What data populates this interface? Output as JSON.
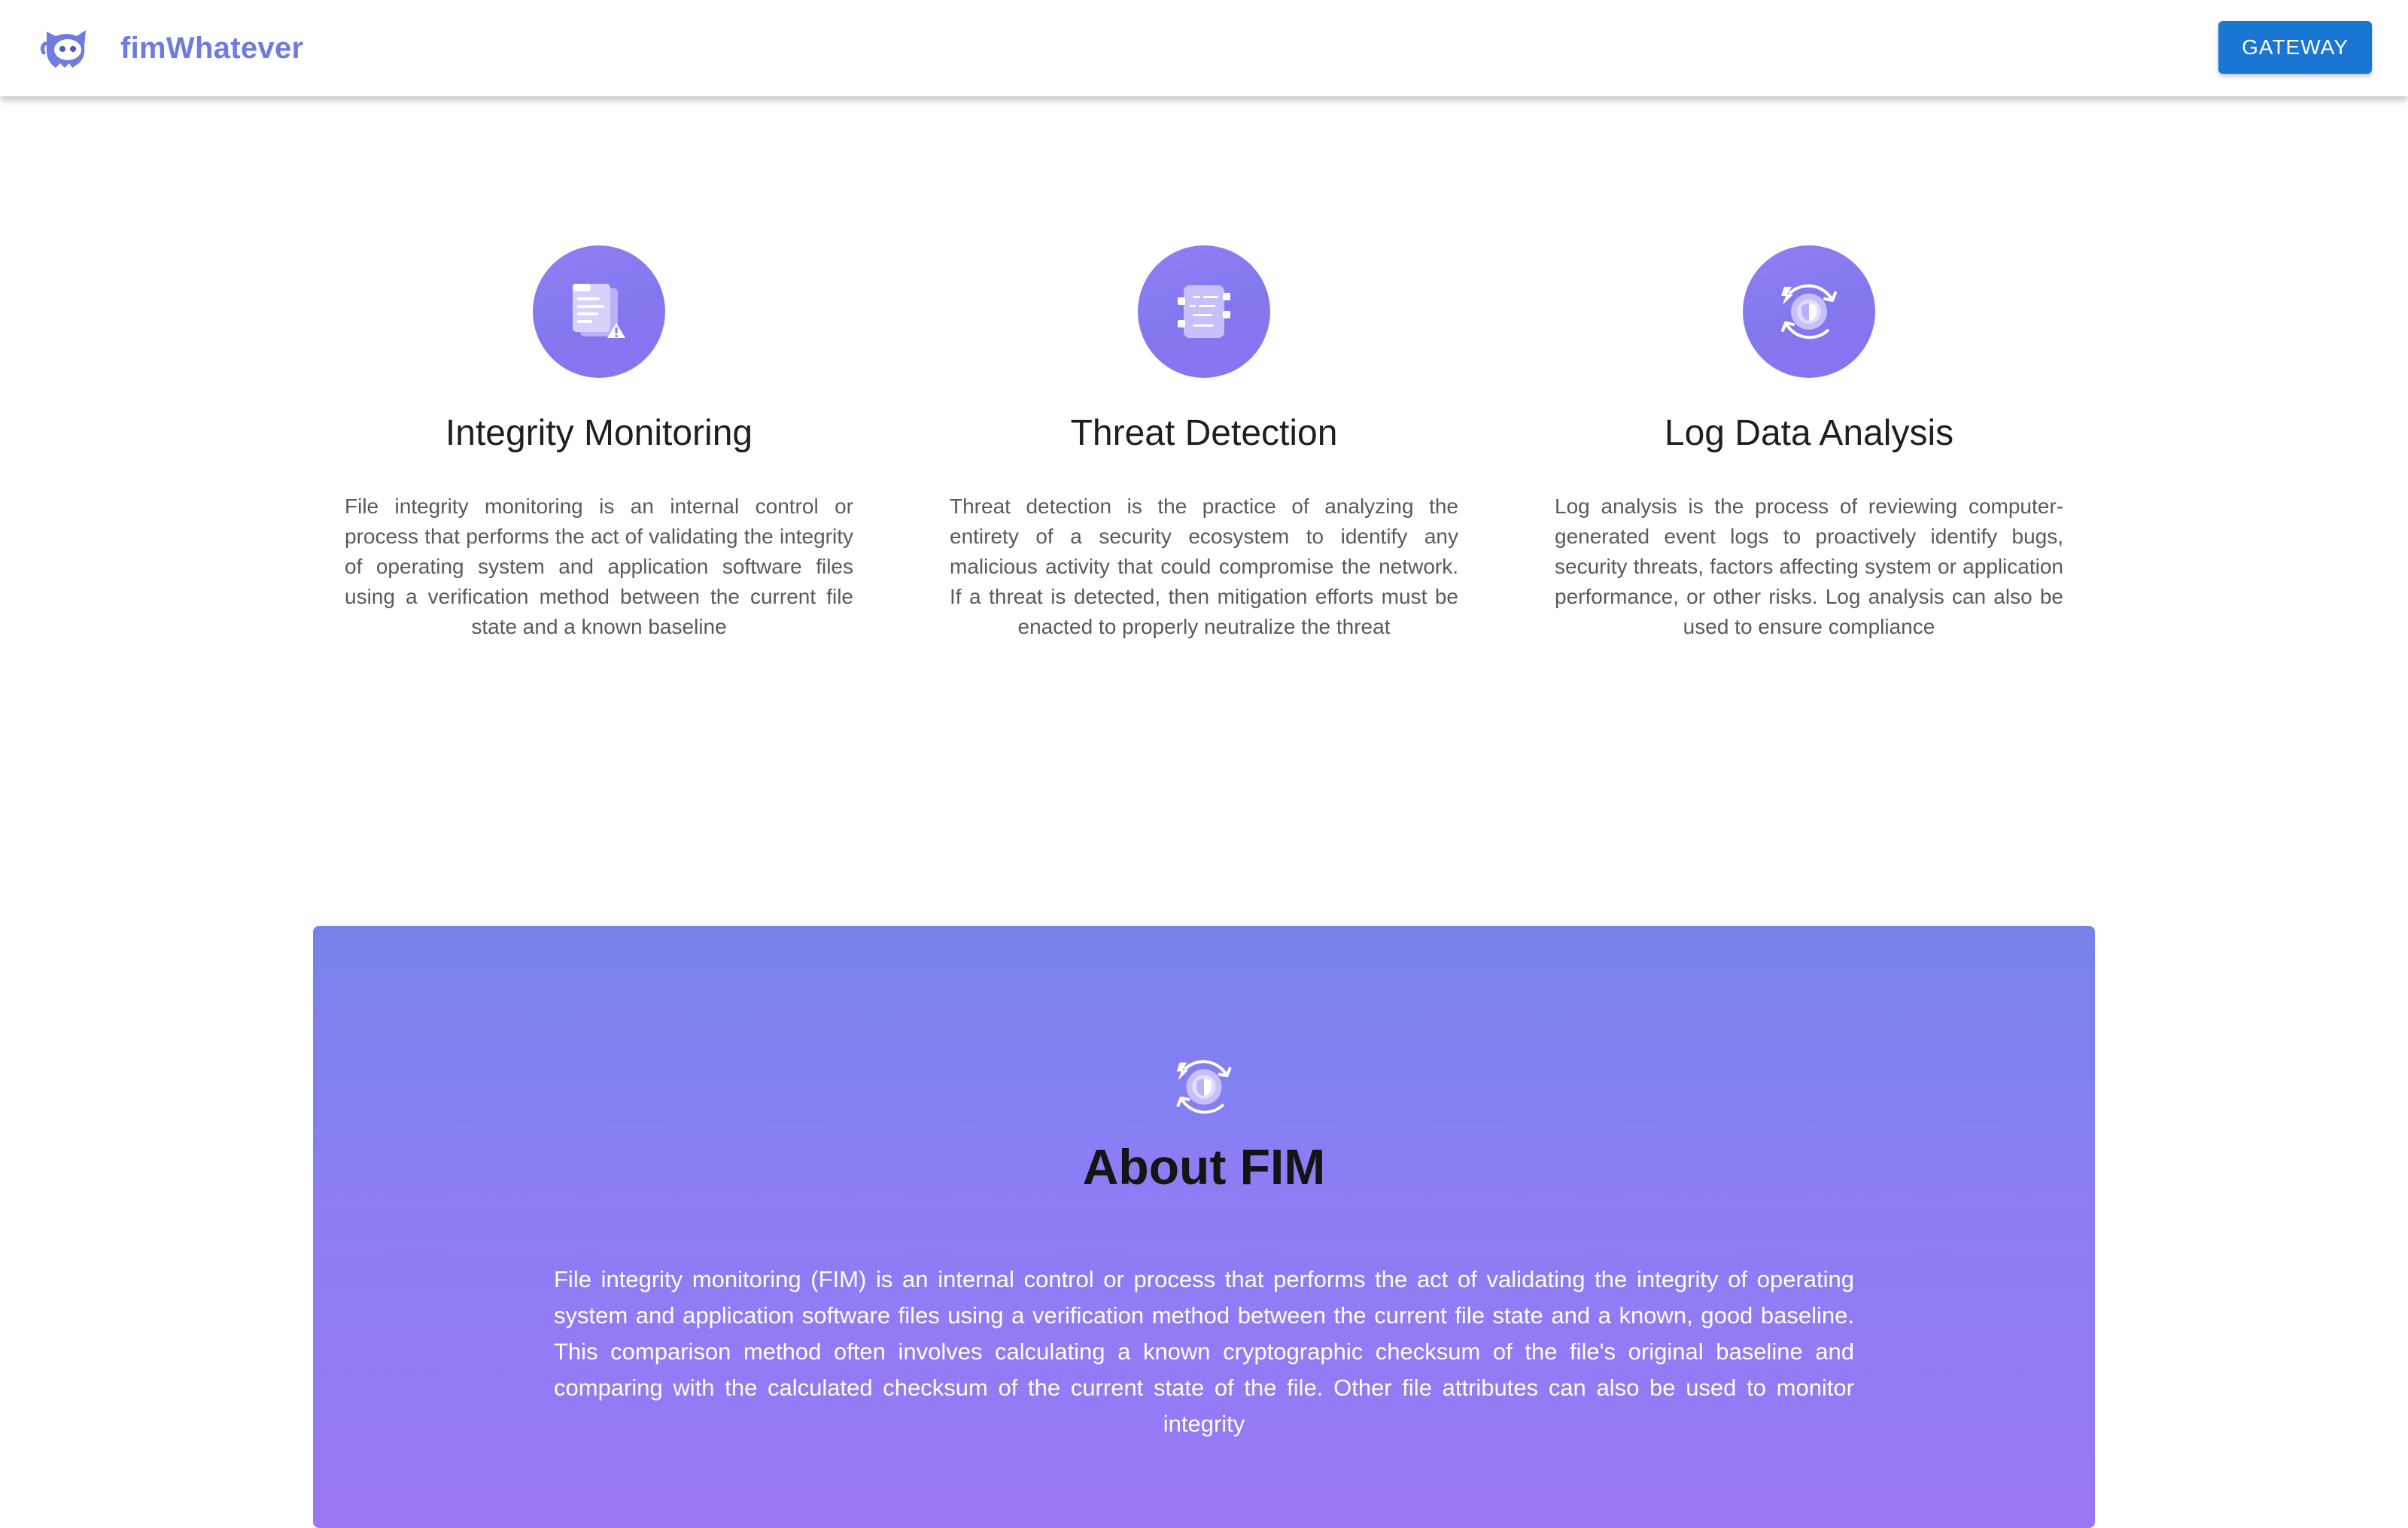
{
  "header": {
    "brand_name": "fimWhatever",
    "logo_icon": "ghost-logo-icon",
    "gateway_label": "GATEWAY",
    "accent_color": "#6e7ce0",
    "button_color": "#1976d2"
  },
  "features": [
    {
      "icon": "document-warning-icon",
      "title": "Integrity Monitoring",
      "description": "File integrity monitoring is an internal control or process that performs the act of validating the integrity of operating system and application software files using a verification method between the current file state and a known baseline"
    },
    {
      "icon": "checklist-icon",
      "title": "Threat Detection",
      "description": "Threat detection is the practice of analyzing the entirety of a security ecosystem to identify any malicious activity that could compromise the network. If a threat is detected, then mitigation efforts must be enacted to properly neutralize the threat"
    },
    {
      "icon": "shield-refresh-icon",
      "title": "Log Data Analysis",
      "description": "Log analysis is the process of reviewing computer-generated event logs to proactively identify bugs, security threats, factors affecting system or application performance, or other risks. Log analysis can also be used to ensure compliance"
    }
  ],
  "about": {
    "icon": "shield-refresh-icon",
    "title": "About FIM",
    "text": "File integrity monitoring (FIM) is an internal control or process that performs the act of validating the integrity of operating system and application software files using a verification method between the current file state and a known, good baseline. This comparison method often involves calculating a known cryptographic checksum of the file's original baseline and comparing with the calculated checksum of the current state of the file. Other file attributes can also be used to monitor integrity",
    "gradient_start": "#7683ea",
    "gradient_end": "#9a78f5"
  }
}
